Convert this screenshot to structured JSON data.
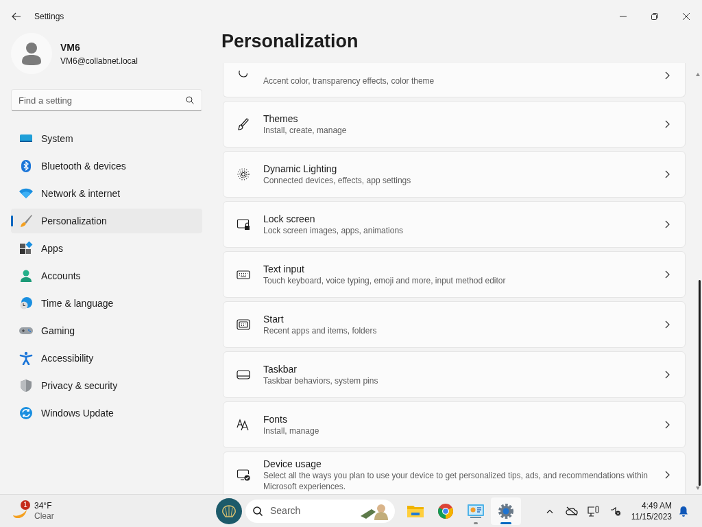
{
  "window": {
    "title": "Settings"
  },
  "user": {
    "name": "VM6",
    "email": "VM6@collabnet.local"
  },
  "search": {
    "placeholder": "Find a setting"
  },
  "nav": [
    {
      "label": "System",
      "selected": false
    },
    {
      "label": "Bluetooth & devices",
      "selected": false
    },
    {
      "label": "Network & internet",
      "selected": false
    },
    {
      "label": "Personalization",
      "selected": true
    },
    {
      "label": "Apps",
      "selected": false
    },
    {
      "label": "Accounts",
      "selected": false
    },
    {
      "label": "Time & language",
      "selected": false
    },
    {
      "label": "Gaming",
      "selected": false
    },
    {
      "label": "Accessibility",
      "selected": false
    },
    {
      "label": "Privacy & security",
      "selected": false
    },
    {
      "label": "Windows Update",
      "selected": false
    }
  ],
  "page_title": "Personalization",
  "cards": [
    {
      "subtitle": "Accent color, transparency effects, color theme"
    },
    {
      "title": "Themes",
      "subtitle": "Install, create, manage"
    },
    {
      "title": "Dynamic Lighting",
      "subtitle": "Connected devices, effects, app settings"
    },
    {
      "title": "Lock screen",
      "subtitle": "Lock screen images, apps, animations"
    },
    {
      "title": "Text input",
      "subtitle": "Touch keyboard, voice typing, emoji and more, input method editor"
    },
    {
      "title": "Start",
      "subtitle": "Recent apps and items, folders"
    },
    {
      "title": "Taskbar",
      "subtitle": "Taskbar behaviors, system pins"
    },
    {
      "title": "Fonts",
      "subtitle": "Install, manage"
    },
    {
      "title": "Device usage",
      "subtitle": "Select all the ways you plan to use your device to get personalized tips, ads, and recommendations within Microsoft experiences."
    }
  ],
  "taskbar": {
    "weather": {
      "badge": "1",
      "temperature": "34°F",
      "condition": "Clear"
    },
    "search_placeholder": "Search",
    "apps": [
      {
        "active": false,
        "running": false
      },
      {
        "active": false,
        "running": false
      },
      {
        "active": false,
        "running": true
      },
      {
        "active": true,
        "running": true
      }
    ],
    "time": "4:49 AM",
    "date": "11/15/2023"
  }
}
